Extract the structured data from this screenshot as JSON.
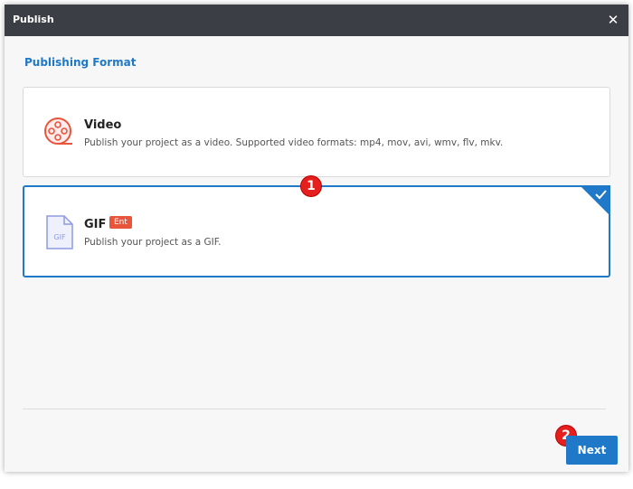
{
  "dialog": {
    "title": "Publish",
    "close_glyph": "✕"
  },
  "section": {
    "title": "Publishing Format"
  },
  "formats": [
    {
      "name": "Video",
      "description": "Publish your project as a video. Supported video formats: mp4, mov, avi, wmv, flv, mkv.",
      "icon": "film-reel-icon",
      "selected": false
    },
    {
      "name": "GIF",
      "badge": "Ent",
      "icon_text": "GIF",
      "description": "Publish your project as a GIF.",
      "icon": "gif-file-icon",
      "selected": true
    }
  ],
  "annotations": {
    "marker_1": "1",
    "marker_2": "2"
  },
  "footer": {
    "next_label": "Next"
  },
  "colors": {
    "accent": "#1f78c8",
    "titlebar": "#3b3f45",
    "badge": "#e8553b",
    "marker": "#e51e1e"
  }
}
